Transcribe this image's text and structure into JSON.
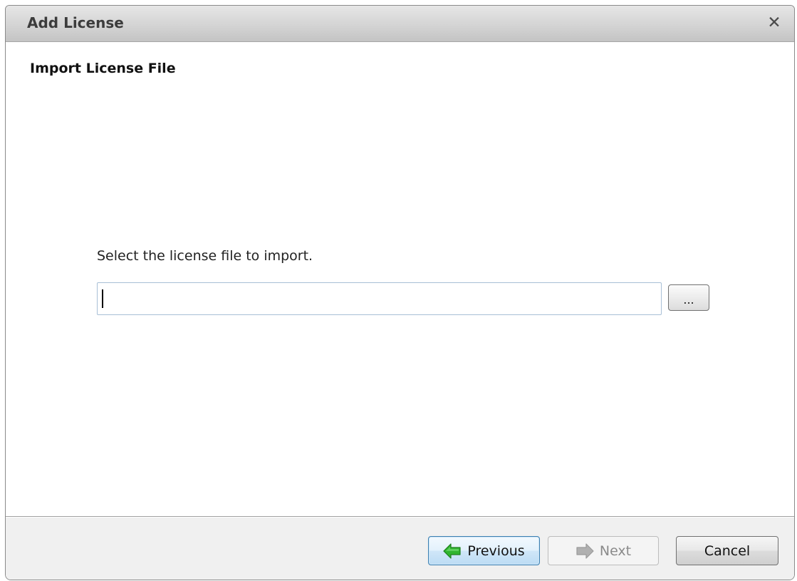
{
  "window": {
    "title": "Add License",
    "close_icon": "close-icon",
    "close_glyph": "✕"
  },
  "page": {
    "section_title": "Import License File",
    "prompt": "Select the license file to import."
  },
  "file_field": {
    "value": "",
    "placeholder": ""
  },
  "browse_button": {
    "label": "..."
  },
  "buttons": {
    "previous": {
      "label": "Previous",
      "icon": "arrow-left-icon",
      "color": "#2fb52f"
    },
    "next": {
      "label": "Next",
      "icon": "arrow-right-icon",
      "disabled": true,
      "color": "#a9a9a9"
    },
    "cancel": {
      "label": "Cancel"
    }
  }
}
